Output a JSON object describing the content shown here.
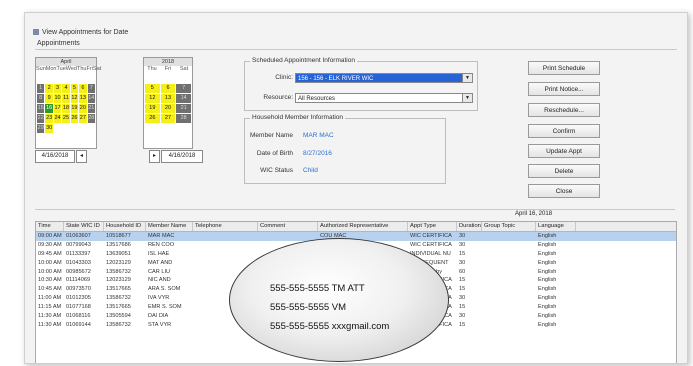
{
  "window": {
    "title": "View Appointments for Date",
    "group_label": "Appointments"
  },
  "calendar": {
    "left": {
      "month": "April",
      "days_header": [
        "Sun",
        "Mon",
        "Tue",
        "Wed",
        "Thu",
        "Fri",
        "Sat"
      ],
      "cells": [
        {
          "t": "",
          "s": "emp"
        },
        {
          "t": "",
          "s": "emp"
        },
        {
          "t": "",
          "s": "emp"
        },
        {
          "t": "",
          "s": "emp"
        },
        {
          "t": "",
          "s": "emp"
        },
        {
          "t": "",
          "s": "emp"
        },
        {
          "t": "",
          "s": "emp"
        },
        {
          "t": "1",
          "s": "gry"
        },
        {
          "t": "2",
          "s": "yel"
        },
        {
          "t": "3",
          "s": "yel"
        },
        {
          "t": "4",
          "s": "yel"
        },
        {
          "t": "5",
          "s": "yel"
        },
        {
          "t": "6",
          "s": "yel"
        },
        {
          "t": "7",
          "s": "gry"
        },
        {
          "t": "8",
          "s": "gry"
        },
        {
          "t": "9",
          "s": "yel"
        },
        {
          "t": "10",
          "s": "yel"
        },
        {
          "t": "11",
          "s": "yel"
        },
        {
          "t": "12",
          "s": "yel"
        },
        {
          "t": "13",
          "s": "yel"
        },
        {
          "t": "14",
          "s": "gry"
        },
        {
          "t": "15",
          "s": "gry"
        },
        {
          "t": "16",
          "s": "grn"
        },
        {
          "t": "17",
          "s": "yel"
        },
        {
          "t": "18",
          "s": "yel"
        },
        {
          "t": "19",
          "s": "yel"
        },
        {
          "t": "20",
          "s": "yel"
        },
        {
          "t": "21",
          "s": "gry"
        },
        {
          "t": "22",
          "s": "gry"
        },
        {
          "t": "23",
          "s": "yel"
        },
        {
          "t": "24",
          "s": "yel"
        },
        {
          "t": "25",
          "s": "yel"
        },
        {
          "t": "26",
          "s": "yel"
        },
        {
          "t": "27",
          "s": "yel"
        },
        {
          "t": "28",
          "s": "gry"
        },
        {
          "t": "29",
          "s": "gry"
        },
        {
          "t": "30",
          "s": "yel"
        },
        {
          "t": "",
          "s": "emp"
        },
        {
          "t": "",
          "s": "emp"
        },
        {
          "t": "",
          "s": "emp"
        },
        {
          "t": "",
          "s": "emp"
        },
        {
          "t": "",
          "s": "emp"
        }
      ]
    },
    "right": {
      "month": "2018",
      "days_header": [
        "Thu",
        "Fri",
        "Sat"
      ],
      "cells": [
        {
          "t": "",
          "s": "emp"
        },
        {
          "t": "",
          "s": "emp"
        },
        {
          "t": "",
          "s": "emp"
        },
        {
          "t": "5",
          "s": "yel"
        },
        {
          "t": "6",
          "s": "yel"
        },
        {
          "t": "7",
          "s": "gry"
        },
        {
          "t": "12",
          "s": "yel"
        },
        {
          "t": "13",
          "s": "yel"
        },
        {
          "t": "14",
          "s": "gry"
        },
        {
          "t": "19",
          "s": "yel"
        },
        {
          "t": "20",
          "s": "yel"
        },
        {
          "t": "21",
          "s": "gry"
        },
        {
          "t": "26",
          "s": "yel"
        },
        {
          "t": "27",
          "s": "yel"
        },
        {
          "t": "28",
          "s": "gry"
        },
        {
          "t": "",
          "s": "emp"
        },
        {
          "t": "",
          "s": "emp"
        },
        {
          "t": "",
          "s": "emp"
        }
      ]
    },
    "date_left": "4/16/2018",
    "nav_prev": "◂",
    "nav_next": "▸",
    "date_right": "4/16/2018"
  },
  "scheduled": {
    "title": "Scheduled Appointment Information",
    "clinic_label": "Clinic:",
    "clinic_value": "156 - 156 - ELK RIVER WIC",
    "resource_label": "Resource:",
    "resource_value": "All Resources"
  },
  "household": {
    "title": "Household Member Information",
    "member_name_label": "Member Name",
    "member_name_value": "MAR MAC",
    "dob_label": "Date of Birth",
    "dob_value": "8/27/2016",
    "wic_status_label": "WIC Status",
    "wic_status_value": "Child"
  },
  "buttons": [
    "Print Schedule",
    "Print Notice...",
    "Reschedule...",
    "Confirm",
    "Update Appt",
    "Delete",
    "Close"
  ],
  "table": {
    "date_banner": "April 16, 2018",
    "columns": [
      "Time",
      "State WIC ID",
      "Household ID",
      "Member Name",
      "Telephone",
      "Comment",
      "Authorized Representative",
      "Appt Type",
      "Duration",
      "Group Topic",
      "Language"
    ],
    "rows": [
      [
        "09:00 AM",
        "01063607",
        "10518677",
        "MAR MAC",
        "",
        "",
        "COU MAC",
        "WIC CERTIFICA",
        "30",
        "",
        "English"
      ],
      [
        "09:30 AM",
        "00799043",
        "13517686",
        "REN COO",
        "",
        "",
        "",
        "WIC CERTIFICA",
        "30",
        "",
        "English"
      ],
      [
        "09:45 AM",
        "01133397",
        "13639051",
        "ISL HAE",
        "",
        "",
        "",
        "INDIVIDUAL NU",
        "15",
        "",
        "English"
      ],
      [
        "10:00 AM",
        "01043303",
        "12023129",
        "MAT AND",
        "",
        "",
        "",
        "SUBSEQUENT",
        "30",
        "",
        "English"
      ],
      [
        "10:00 AM",
        "00985672",
        "13586732",
        "CAR LIU",
        "",
        "",
        "",
        "Mom & Baby",
        "60",
        "",
        "English"
      ],
      [
        "10:30 AM",
        "01114069",
        "12023129",
        "NIC AND",
        "",
        "",
        "",
        "WIC CERTIFICA",
        "15",
        "",
        "English"
      ],
      [
        "10:45 AM",
        "00973570",
        "13517665",
        "ARA S. SOM",
        "",
        "",
        "",
        "WIC CERTIFICA",
        "15",
        "",
        "English"
      ],
      [
        "11:00 AM",
        "01012305",
        "13586732",
        "IVA VYR",
        "",
        "",
        "",
        "WIC CERTIFICA",
        "30",
        "",
        "English"
      ],
      [
        "11:15 AM",
        "01077168",
        "13517665",
        "EMR S. SOM",
        "",
        "",
        "",
        "WIC CERTIFICA",
        "15",
        "",
        "English"
      ],
      [
        "11:30 AM",
        "01068116",
        "13505594",
        "DAI DIA",
        "",
        "",
        "",
        "WIC CERTIFICA",
        "30",
        "",
        "English"
      ],
      [
        "11:30 AM",
        "01069144",
        "13586732",
        "STA VYR",
        "",
        "",
        "",
        "WIC CERTIFICA",
        "15",
        "",
        "English"
      ]
    ]
  },
  "overlay": {
    "line1": "555-555-5555 TM ATT",
    "line2": "555-555-5555 VM",
    "line3": "555-555-5555 xxxgmail.com"
  }
}
